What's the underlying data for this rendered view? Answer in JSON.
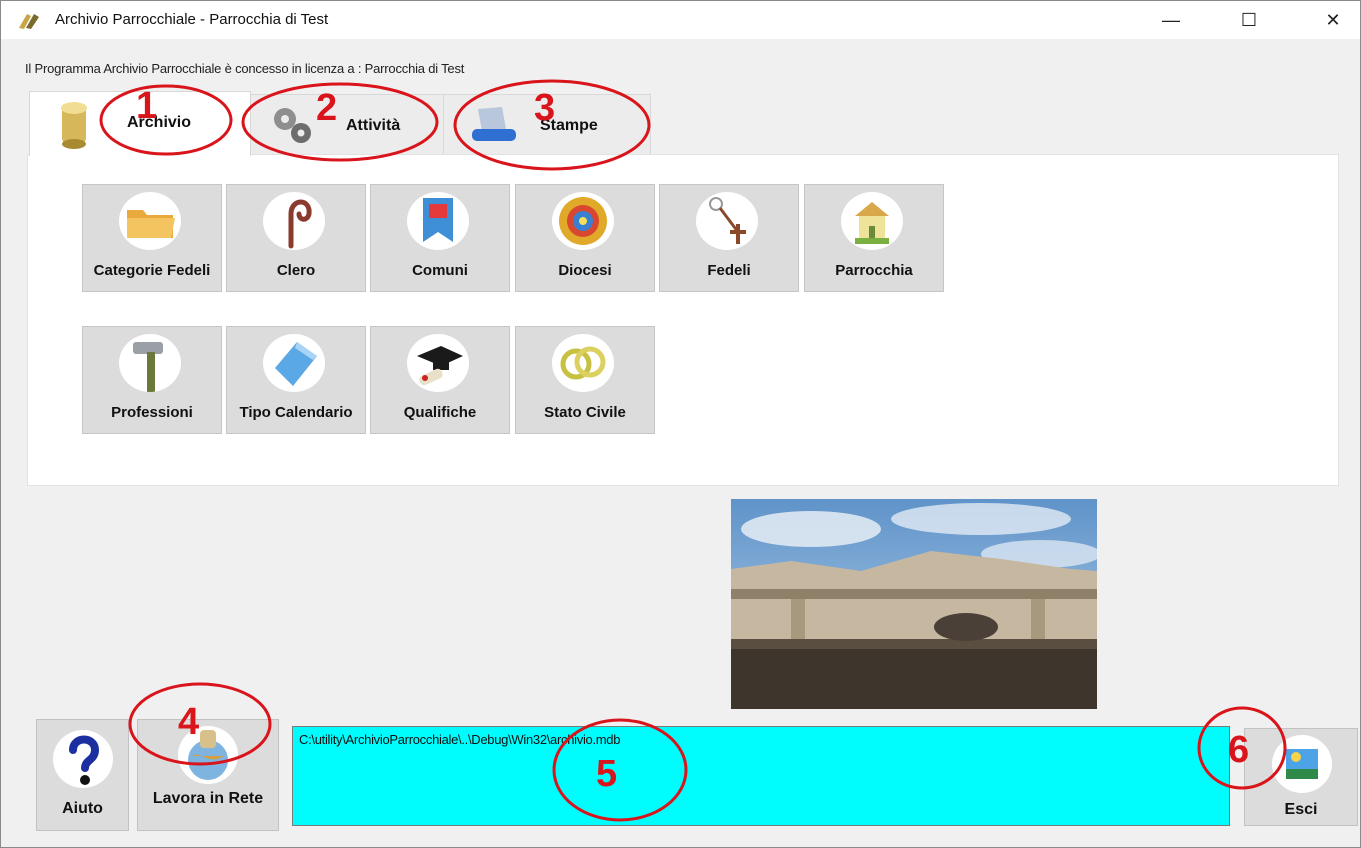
{
  "window": {
    "title": "Archivio Parrocchiale - Parrocchia di Test",
    "minimize_glyph": "—",
    "maximize_glyph": "☐",
    "close_glyph": "✕"
  },
  "license_text": "Il Programma Archivio Parrocchiale è concesso in licenza a : Parrocchia di Test",
  "tabs": [
    {
      "label": "Archivio",
      "icon": "scroll-icon",
      "active": true
    },
    {
      "label": "Attività",
      "icon": "gears-icon",
      "active": false
    },
    {
      "label": "Stampe",
      "icon": "printer-icon",
      "active": false
    }
  ],
  "tiles_row1": [
    {
      "label": "Categorie Fedeli",
      "icon": "folder-icon"
    },
    {
      "label": "Clero",
      "icon": "crozier-icon"
    },
    {
      "label": "Comuni",
      "icon": "banner-icon"
    },
    {
      "label": "Diocesi",
      "icon": "rose-window-icon"
    },
    {
      "label": "Fedeli",
      "icon": "rosary-icon"
    },
    {
      "label": "Parrocchia",
      "icon": "church-icon"
    }
  ],
  "tiles_row2": [
    {
      "label": "Professioni",
      "icon": "hammer-icon"
    },
    {
      "label": "Tipo Calendario",
      "icon": "calendar-icon"
    },
    {
      "label": "Qualifiche",
      "icon": "graduation-cap-icon"
    },
    {
      "label": "Stato Civile",
      "icon": "rings-icon"
    }
  ],
  "bottom": {
    "help_label": "Aiuto",
    "network_label": "Lavora in Rete",
    "exit_label": "Esci",
    "db_path": "C:\\utility\\ArchivioParrocchiale\\..\\Debug\\Win32\\archivio.mdb"
  },
  "annotations": [
    {
      "number": "1"
    },
    {
      "number": "2"
    },
    {
      "number": "3"
    },
    {
      "number": "4"
    },
    {
      "number": "5"
    },
    {
      "number": "6"
    }
  ],
  "colors": {
    "annotation_red": "#d9141b",
    "path_background": "#00fdfd",
    "tile_background": "#dcdcdc"
  }
}
